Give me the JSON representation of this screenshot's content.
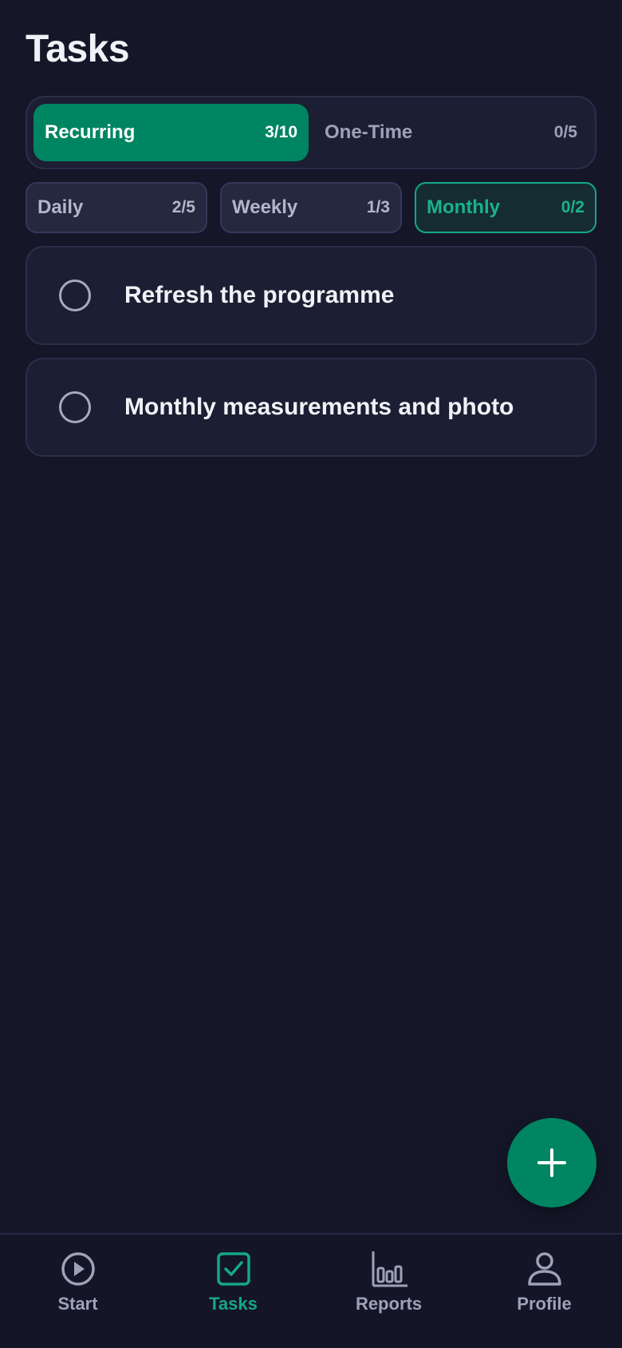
{
  "header": {
    "title": "Tasks"
  },
  "segments": [
    {
      "label": "Recurring",
      "count": "3/10",
      "active": true
    },
    {
      "label": "One-Time",
      "count": "0/5",
      "active": false
    }
  ],
  "periods": [
    {
      "label": "Daily",
      "count": "2/5",
      "active": false
    },
    {
      "label": "Weekly",
      "count": "1/3",
      "active": false
    },
    {
      "label": "Monthly",
      "count": "0/2",
      "active": true
    }
  ],
  "tasks": [
    {
      "title": "Refresh the programme",
      "done": false
    },
    {
      "title": "Monthly measurements and photo",
      "done": false
    }
  ],
  "fab": {
    "icon": "plus-icon"
  },
  "nav": [
    {
      "label": "Start",
      "icon": "play-circle-icon",
      "active": false
    },
    {
      "label": "Tasks",
      "icon": "checkbox-icon",
      "active": true
    },
    {
      "label": "Reports",
      "icon": "bar-chart-icon",
      "active": false
    },
    {
      "label": "Profile",
      "icon": "user-icon",
      "active": false
    }
  ],
  "colors": {
    "background": "#151729",
    "accent": "#008562",
    "accent_text": "#14A884",
    "muted_text": "#9EA2B8"
  }
}
